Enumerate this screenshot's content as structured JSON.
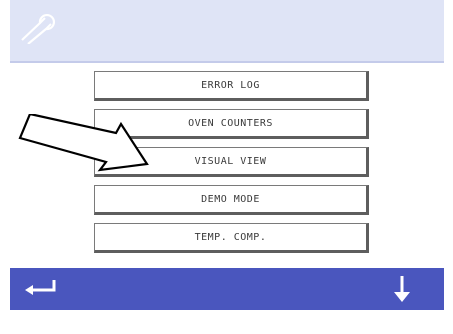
{
  "header": {
    "icon": "wrench-icon"
  },
  "menu": {
    "items": [
      {
        "label": "ERROR LOG"
      },
      {
        "label": "OVEN COUNTERS"
      },
      {
        "label": "VISUAL VIEW"
      },
      {
        "label": "DEMO MODE"
      },
      {
        "label": "TEMP. COMP."
      }
    ]
  },
  "annotation": {
    "icon": "pointer-arrow-icon",
    "points_to": "VISUAL VIEW"
  },
  "footer": {
    "back_icon": "back-return-icon",
    "down_icon": "scroll-down-icon"
  },
  "colors": {
    "header_bg": "#dfe4f6",
    "footer_bg": "#4a56be",
    "button_border": "#5e5e5e",
    "text": "#3a3a3a"
  }
}
